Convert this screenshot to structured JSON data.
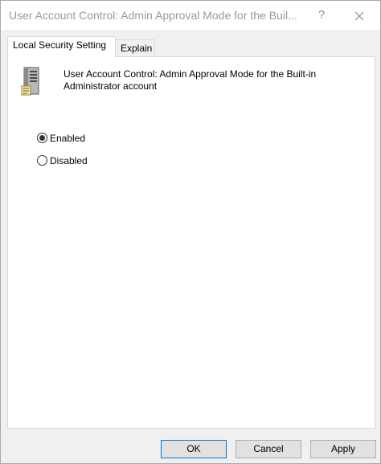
{
  "window": {
    "title": "User Account Control: Admin Approval Mode for the Buil...",
    "help_label": "?"
  },
  "tabs": [
    {
      "label": "Local Security Setting",
      "active": true
    },
    {
      "label": "Explain",
      "active": false
    }
  ],
  "policy": {
    "icon": "server-policy-icon",
    "title": "User Account Control: Admin Approval Mode for the Built-in Administrator account"
  },
  "options": [
    {
      "label": "Enabled",
      "checked": true
    },
    {
      "label": "Disabled",
      "checked": false
    }
  ],
  "buttons": {
    "ok": "OK",
    "cancel": "Cancel",
    "apply": "Apply"
  },
  "colors": {
    "title_text": "#9a9a9a",
    "default_button_border": "#0078d7",
    "dialog_background": "#f0f0f0"
  }
}
